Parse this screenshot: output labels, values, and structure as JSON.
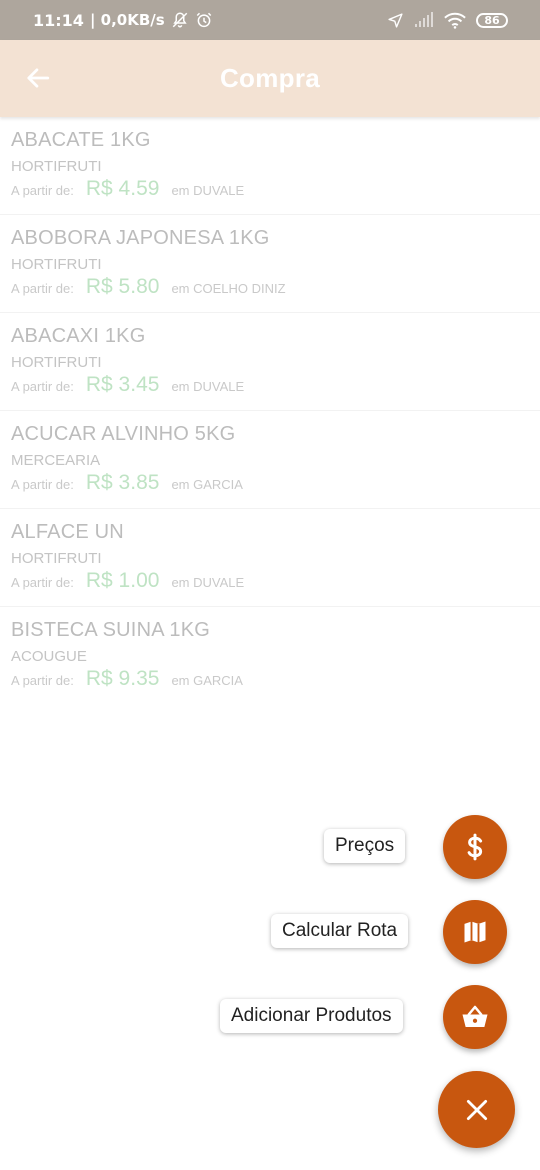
{
  "status_bar": {
    "time": "11:14",
    "network_speed": "| 0,0KB/s",
    "battery": "86"
  },
  "app_bar": {
    "title": "Compra",
    "back_icon": "arrow-back-icon"
  },
  "products": [
    {
      "name": "ABACATE 1KG",
      "category": "HORTIFRUTI",
      "from_label": "A partir de:",
      "price": "R$ 4.59",
      "store": "em DUVALE"
    },
    {
      "name": "ABOBORA JAPONESA 1KG",
      "category": "HORTIFRUTI",
      "from_label": "A partir de:",
      "price": "R$ 5.80",
      "store": "em COELHO DINIZ"
    },
    {
      "name": "ABACAXI 1KG",
      "category": "HORTIFRUTI",
      "from_label": "A partir de:",
      "price": "R$ 3.45",
      "store": "em DUVALE"
    },
    {
      "name": "ACUCAR ALVINHO 5KG",
      "category": "MERCEARIA",
      "from_label": "A partir de:",
      "price": "R$ 3.85",
      "store": "em GARCIA"
    },
    {
      "name": "ALFACE UN",
      "category": "HORTIFRUTI",
      "from_label": "A partir de:",
      "price": "R$ 1.00",
      "store": "em DUVALE"
    },
    {
      "name": "BISTECA SUINA 1KG",
      "category": "ACOUGUE",
      "from_label": "A partir de:",
      "price": "R$ 9.35",
      "store": "em GARCIA"
    }
  ],
  "fab_menu": {
    "prices_label": "Preços",
    "route_label": "Calcular Rota",
    "add_label": "Adicionar Produtos",
    "prices_icon": "dollar-icon",
    "route_icon": "map-icon",
    "add_icon": "basket-icon",
    "close_icon": "close-icon"
  },
  "colors": {
    "status_bar": "#aea69d",
    "app_bar": "#f3e2d3",
    "accent": "#c8570f",
    "price_green": "#bfe3c4"
  }
}
